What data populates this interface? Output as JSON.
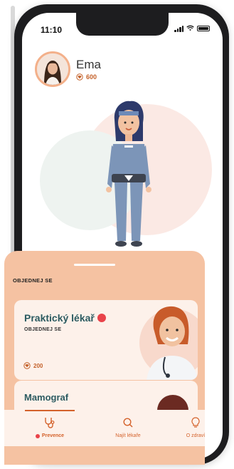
{
  "status": {
    "time": "11:10"
  },
  "profile": {
    "name": "Ema",
    "points": "600"
  },
  "section": {
    "title": "OBJEDNEJ SE"
  },
  "cards": [
    {
      "title": "Praktický lékař",
      "subtitle": "OBJEDNEJ SE",
      "points": "200"
    },
    {
      "title": "Mamograf"
    }
  ],
  "tabs": [
    {
      "label": "Prevence",
      "icon": "stethoscope-icon",
      "active": true
    },
    {
      "label": "Najít lékaře",
      "icon": "search-icon"
    },
    {
      "label": "O zdraví",
      "icon": "lightbulb-icon"
    }
  ],
  "colors": {
    "accent": "#d4622b",
    "sheet": "#f5c2a2",
    "card": "#fdf1ea",
    "title": "#2c5b61",
    "alert": "#e9434a"
  }
}
